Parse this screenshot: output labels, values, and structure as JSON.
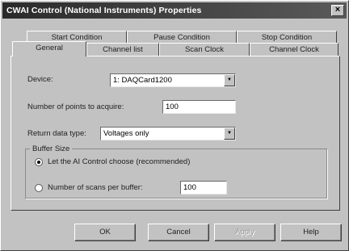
{
  "window": {
    "title": "CWAI Control (National Instruments) Properties"
  },
  "tabs_back": [
    {
      "label": "Start Condition"
    },
    {
      "label": "Pause Condition"
    },
    {
      "label": "Stop Condition"
    }
  ],
  "tabs_front": [
    {
      "label": "General",
      "active": true
    },
    {
      "label": "Channel list"
    },
    {
      "label": "Scan Clock"
    },
    {
      "label": "Channel Clock"
    }
  ],
  "general": {
    "device_label": "Device:",
    "device_value": "1: DAQCard1200",
    "num_points_label": "Number of points to acquire:",
    "num_points_value": "100",
    "return_type_label": "Return data type:",
    "return_type_value": "Voltages only",
    "buffer_size": {
      "title": "Buffer Size",
      "option_auto": "Let the AI Control choose (recommended)",
      "option_manual": "Number of scans per buffer:",
      "manual_value": "100",
      "selected": "auto"
    }
  },
  "buttons": {
    "ok": "OK",
    "cancel": "Cancel",
    "apply": "Apply",
    "help": "Help"
  }
}
